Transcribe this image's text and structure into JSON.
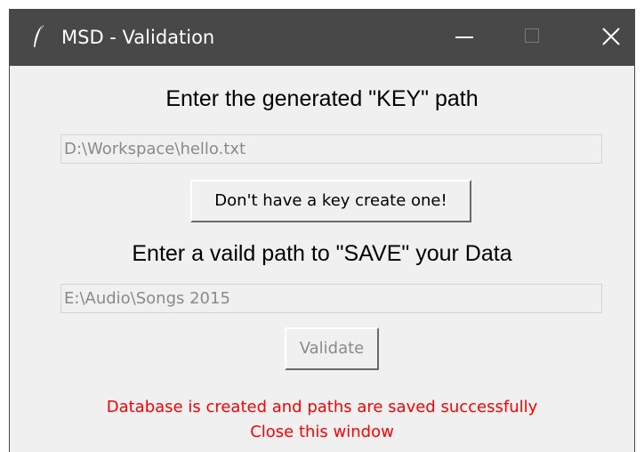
{
  "window": {
    "title": "MSD - Validation",
    "controls": {
      "minimize": "minimize-icon",
      "maximize": "maximize-icon",
      "close": "close-icon"
    }
  },
  "key_section": {
    "heading": "Enter the generated \"KEY\" path",
    "path_value": "D:\\Workspace\\hello.txt",
    "create_button_label": "Don't have a key create one!"
  },
  "save_section": {
    "heading": "Enter a vaild path to \"SAVE\" your Data",
    "path_value": "E:\\Audio\\Songs 2015",
    "validate_button_label": "Validate"
  },
  "status": {
    "line1": "Database is created and paths are saved successfully",
    "line2": "Close this window"
  },
  "colors": {
    "titlebar": "#484848",
    "window_bg": "#f0f0f0",
    "disabled_text": "#8a8a8a",
    "status_text": "#ff0000"
  }
}
